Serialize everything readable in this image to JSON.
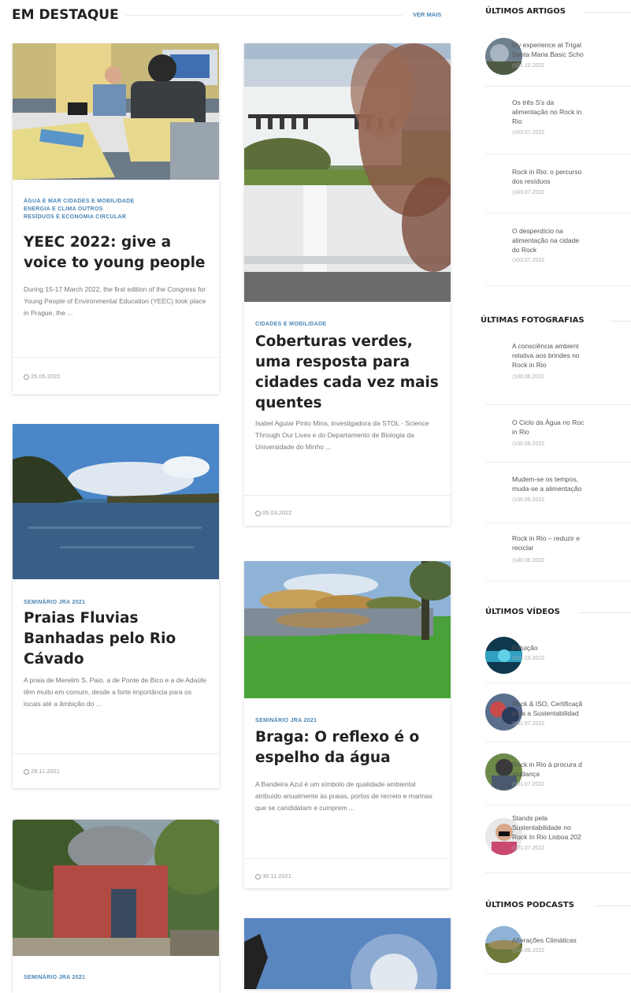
{
  "main": {
    "section_title": "EM DESTAQUE",
    "see_more": "VER MAIS",
    "cards": [
      {
        "categories": [
          "ÁGUA E MAR CIDADES E MOBILIDADE",
          "ENERGIA E CLIMA OUTROS",
          "RESÍDUOS E ECONOMIA CIRCULAR"
        ],
        "title": "YEEC 2022: give a voice to young people",
        "excerpt": "During 15-17 March 2022, the first edition of the Congress for Young People of Environmental Education (YEEC) took place in Prague, the ...",
        "date": "25.05.2022"
      },
      {
        "categories": [
          "CIDADES E MOBILIDADE"
        ],
        "title": "Coberturas verdes, uma resposta para cidades cada vez mais quentes",
        "excerpt": "Isabel Aguiar Pinto Mina, investigadora da STOL - Science Through Our Lives e do Departamento de Biologia da Universidade do Minho ...",
        "date": "05.03.2022"
      },
      {
        "categories": [
          "SEMINÁRIO JRA 2021"
        ],
        "title": "Praias Fluvias Banhadas pelo Rio Cávado",
        "excerpt": "A praia de Merelim S. Paio, a de Ponte de Bico e a de Adaúfe têm muito em comum, desde a forte importância para os locais até a âmbição do ...",
        "date": "29.11.2021"
      },
      {
        "categories": [
          "SEMINÁRIO JRA 2021"
        ],
        "title": "Braga: O reflexo é o espelho da água",
        "excerpt": "A Bandeira Azul é um símbolo de qualidade ambiental atribuído anualmente às praias, portos de recreio e marinas que se candidatam e cumprem ...",
        "date": "30.11.2021"
      },
      {
        "categories": [
          "SEMINÁRIO JRA 2021"
        ],
        "title": "",
        "excerpt": "",
        "date": ""
      }
    ]
  },
  "sidebar": {
    "articles": {
      "title": "ÚLTIMOS ARTIGOS",
      "items": [
        {
          "title": "My experience at Trigal\nSanta Maria Basic Scho",
          "date": "21.10.2022"
        },
        {
          "title": "Os três S's da\nalimentação no Rock in\nRio",
          "date": "03.07.2022"
        },
        {
          "title": "Rock in Rio: o percurso\ndos resíduos",
          "date": "03.07.2022"
        },
        {
          "title": "O desperdício na\nalimentação na cidade\ndo Rock",
          "date": "03.07.2022"
        }
      ]
    },
    "photos": {
      "title": "ÚLTIMAS FOTOGRAFIAS",
      "items": [
        {
          "title": "A consciência ambient\nrelativa aos brindes no\nRock in Rio",
          "date": "30.06.2022"
        },
        {
          "title": "O Ciclo da Água no Roc\nin Rio",
          "date": "30.06.2022"
        },
        {
          "title": "Mudem-se os tempos,\nmuda-se a alimentação",
          "date": "30.06.2022"
        },
        {
          "title": "Rock in Rio – reduzir e\nreciclar",
          "date": "30.06.2022"
        }
      ]
    },
    "videos": {
      "title": "ÚLTIMOS VÍDEOS",
      "items": [
        {
          "title": "Poluição",
          "date": "21.10.2022"
        },
        {
          "title": "Rock & ISO, Certificaçã\npara a Sustentabilidad",
          "date": "01.07.2022"
        },
        {
          "title": "Rock in Rio à procura d\nmudança",
          "date": "01.07.2022"
        },
        {
          "title": "Stands pela\nSustentabilidade no\nRock In Rio Lisboa 202",
          "date": "01.07.2022"
        }
      ]
    },
    "podcasts": {
      "title": "ÚLTIMOS PODCASTS",
      "items": [
        {
          "title": "Alterações Climáticas",
          "date": "15.06.2022"
        }
      ]
    }
  }
}
